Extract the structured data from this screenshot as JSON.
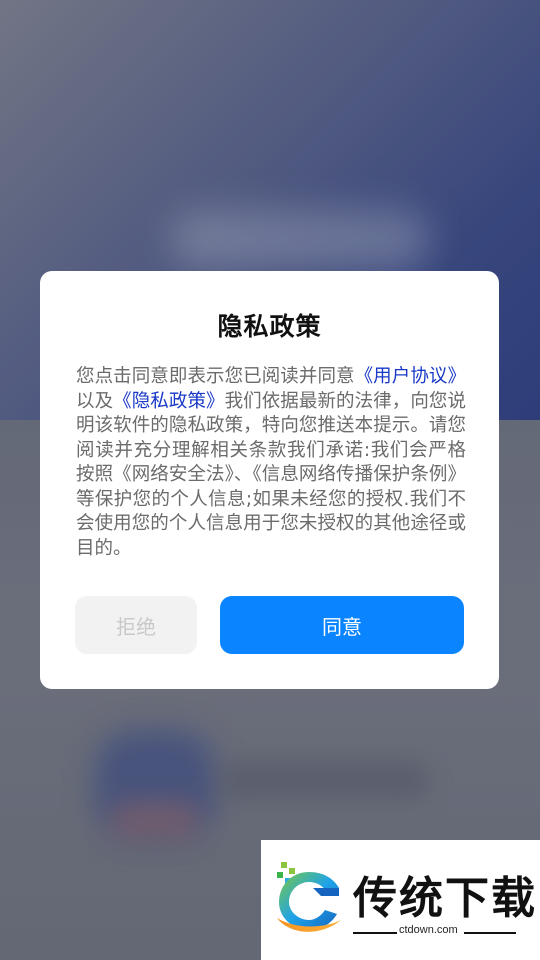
{
  "dialog": {
    "title": "隐私政策",
    "text_1": "您点击同意即表示您已阅读并同意",
    "link_user_agreement": "《用户协议》",
    "text_2": "以及",
    "link_privacy_policy": "《隐私政策》",
    "text_3": "我们依据最新的法律，向您说明该软件的隐私政策，特向您推送本提示。请您阅读并充分理解相关条款我们承诺:我们会严格按照《网络安全法》、《信息网络传播保护条例》等保护您的个人信息;如果未经您的授权.我们不会使用您的个人信息用于您未授权的其他途径或目的。",
    "reject_label": "拒绝",
    "agree_label": "同意"
  },
  "watermark": {
    "brand": "传统下载",
    "url": "ctdown.com"
  },
  "colors": {
    "agree_button": "#0a84ff",
    "link": "#1a39c8",
    "reject_button": "#f2f2f2"
  }
}
